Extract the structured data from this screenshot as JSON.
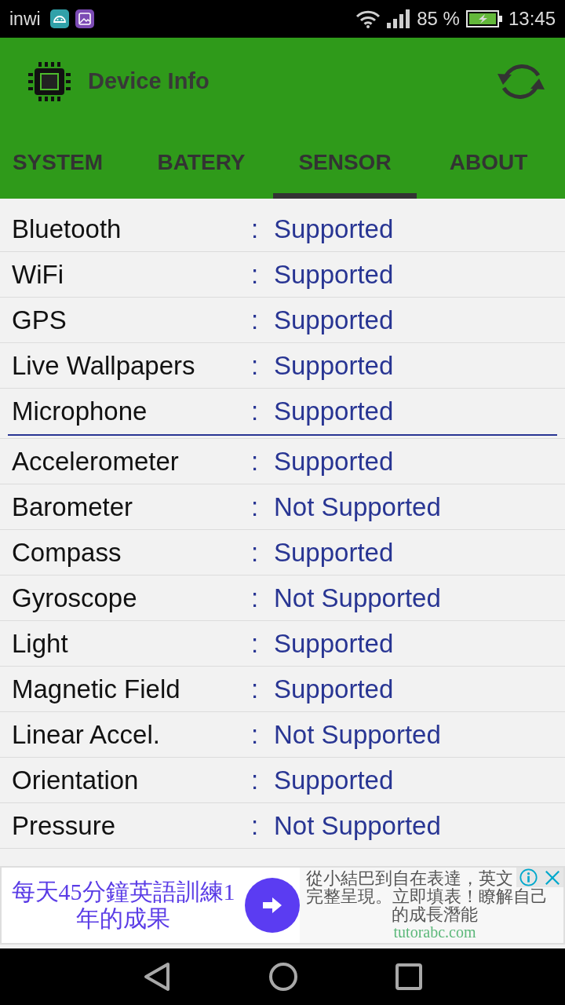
{
  "status_bar": {
    "carrier": "inwi",
    "battery_percent": "85 %",
    "time": "13:45"
  },
  "app_bar": {
    "title": "Device Info"
  },
  "tabs": [
    {
      "label": "SYSTEM",
      "selected": false
    },
    {
      "label": "BATERY",
      "selected": false
    },
    {
      "label": "SENSOR",
      "selected": true
    },
    {
      "label": "ABOUT",
      "selected": false
    }
  ],
  "sections": [
    {
      "rows": [
        {
          "label": "Bluetooth",
          "separator": ":",
          "value": "Supported"
        },
        {
          "label": "WiFi",
          "separator": ":",
          "value": "Supported"
        },
        {
          "label": "GPS",
          "separator": ":",
          "value": "Supported"
        },
        {
          "label": "Live Wallpapers",
          "separator": ":",
          "value": "Supported"
        },
        {
          "label": "Microphone",
          "separator": ":",
          "value": "Supported"
        }
      ]
    },
    {
      "rows": [
        {
          "label": "Accelerometer",
          "separator": ":",
          "value": "Supported"
        },
        {
          "label": "Barometer",
          "separator": ":",
          "value": "Not Supported"
        },
        {
          "label": "Compass",
          "separator": ":",
          "value": "Supported"
        },
        {
          "label": "Gyroscope",
          "separator": ":",
          "value": "Not Supported"
        },
        {
          "label": "Light",
          "separator": ":",
          "value": "Supported"
        },
        {
          "label": "Magnetic Field",
          "separator": ":",
          "value": "Supported"
        },
        {
          "label": "Linear Accel.",
          "separator": ":",
          "value": "Not Supported"
        },
        {
          "label": "Orientation",
          "separator": ":",
          "value": "Supported"
        },
        {
          "label": "Pressure",
          "separator": ":",
          "value": "Not Supported"
        }
      ]
    }
  ],
  "ad": {
    "headline": "每天45分鐘英語訓練1年的成果",
    "description_lines": [
      "從小結巴到自在表達，英文",
      "完整呈現。立即填表！瞭解自己",
      "的成長潛能"
    ],
    "domain": "tutorabc.com"
  }
}
